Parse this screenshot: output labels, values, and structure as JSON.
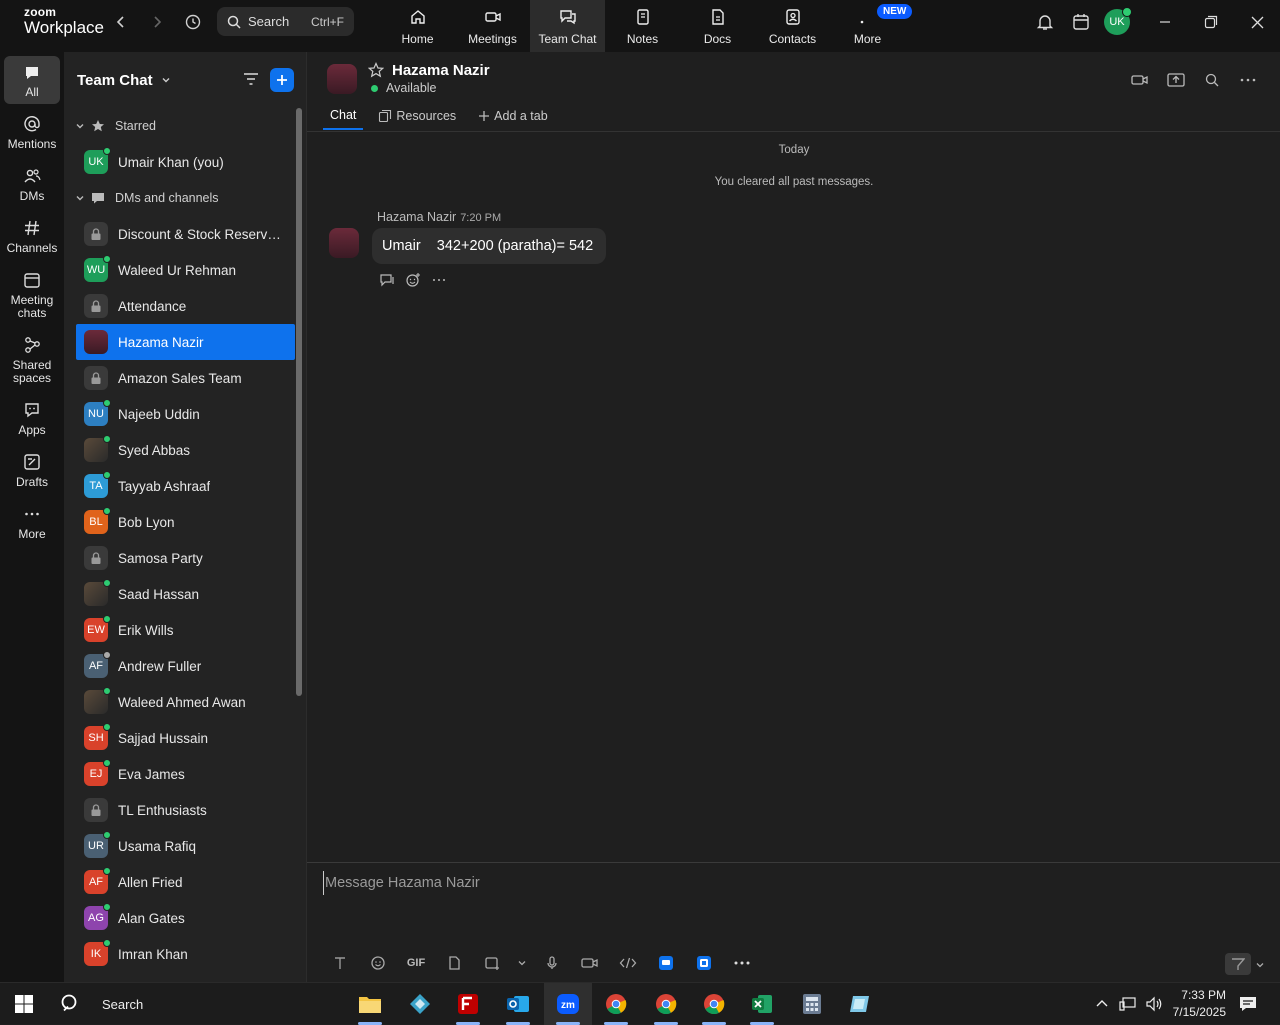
{
  "app": {
    "logo_line1": "zoom",
    "logo_line2": "Workplace"
  },
  "search": {
    "label": "Search",
    "shortcut": "Ctrl+F"
  },
  "topnav": [
    {
      "label": "Home",
      "icon": "home-icon"
    },
    {
      "label": "Meetings",
      "icon": "video-icon"
    },
    {
      "label": "Team Chat",
      "icon": "chat-icon",
      "active": true
    },
    {
      "label": "Notes",
      "icon": "notes-icon"
    },
    {
      "label": "Docs",
      "icon": "docs-icon"
    },
    {
      "label": "Contacts",
      "icon": "contacts-icon"
    },
    {
      "label": "More",
      "icon": "more-icon",
      "badge": "NEW"
    }
  ],
  "user": {
    "initials": "UK"
  },
  "rail": [
    {
      "label": "All"
    },
    {
      "label": "Mentions"
    },
    {
      "label": "DMs"
    },
    {
      "label": "Channels"
    },
    {
      "label": "Meeting chats"
    },
    {
      "label": "Shared spaces"
    },
    {
      "label": "Apps"
    },
    {
      "label": "Drafts"
    },
    {
      "label": "More"
    }
  ],
  "sidebar": {
    "title": "Team Chat",
    "starred_label": "Starred",
    "starred": [
      {
        "name": "Umair Khan (you)",
        "initials": "UK",
        "color": "#1e9e5a"
      }
    ],
    "dms_label": "DMs and channels",
    "items": [
      {
        "name": "Discount & Stock Reservati...",
        "type": "channel"
      },
      {
        "name": "Waleed Ur Rehman",
        "initials": "WU",
        "color": "#1e9e5a"
      },
      {
        "name": "Attendance",
        "type": "channel"
      },
      {
        "name": "Hazama Nazir",
        "type": "photo",
        "active": true
      },
      {
        "name": "Amazon Sales Team",
        "type": "channel"
      },
      {
        "name": "Najeeb Uddin",
        "initials": "NU",
        "color": "#2d7fc1"
      },
      {
        "name": "Syed Abbas",
        "type": "photo"
      },
      {
        "name": "Tayyab Ashraaf",
        "initials": "TA",
        "color": "#2d9bd6"
      },
      {
        "name": "Bob Lyon",
        "initials": "BL",
        "color": "#e0631b"
      },
      {
        "name": "Samosa Party",
        "type": "channel"
      },
      {
        "name": "Saad Hassan",
        "type": "photo"
      },
      {
        "name": "Erik Wills",
        "initials": "EW",
        "color": "#d9422b"
      },
      {
        "name": "Andrew Fuller",
        "initials": "AF",
        "color": "#4a6073",
        "away": true
      },
      {
        "name": "Waleed Ahmed Awan",
        "type": "photo"
      },
      {
        "name": "Sajjad Hussain",
        "initials": "SH",
        "color": "#d9422b"
      },
      {
        "name": "Eva James",
        "initials": "EJ",
        "color": "#d9422b"
      },
      {
        "name": "TL Enthusiasts",
        "type": "channel"
      },
      {
        "name": "Usama Rafiq",
        "initials": "UR",
        "color": "#4a6073"
      },
      {
        "name": "Allen Fried",
        "initials": "AF",
        "color": "#d9422b"
      },
      {
        "name": "Alan Gates",
        "initials": "AG",
        "color": "#8e44ad"
      },
      {
        "name": "Imran Khan",
        "initials": "IK",
        "color": "#d9422b"
      }
    ]
  },
  "chat": {
    "name": "Hazama Nazir",
    "status": "Available",
    "tabs": [
      "Chat",
      "Resources",
      "Add a tab"
    ],
    "day_label": "Today",
    "cleared_notice": "You cleared all past messages.",
    "message": {
      "sender": "Hazama Nazir",
      "time": "7:20 PM",
      "text": "Umair    342+200 (paratha)= 542"
    },
    "composer_placeholder": "Message Hazama Nazir",
    "gif_label": "GIF"
  },
  "taskbar": {
    "search": "Search",
    "time": "7:33 PM",
    "date": "7/15/2025"
  }
}
